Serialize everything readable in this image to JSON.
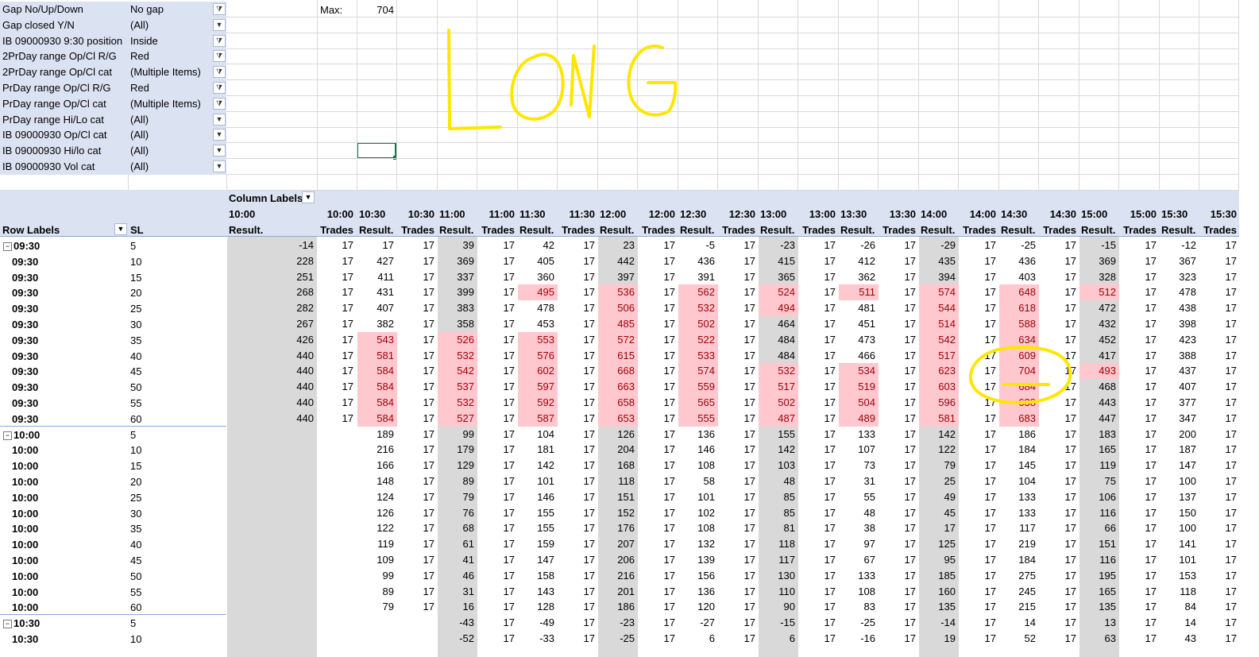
{
  "filters": [
    {
      "label": "Gap No/Up/Down",
      "value": "No gap",
      "filtered": true
    },
    {
      "label": "Gap closed Y/N",
      "value": "(All)",
      "filtered": false
    },
    {
      "label": "IB 09000930 9:30 position",
      "value": "Inside",
      "filtered": true
    },
    {
      "label": "2PrDay range Op/Cl R/G",
      "value": "Red",
      "filtered": true
    },
    {
      "label": "2PrDay range Op/Cl cat",
      "value": "(Multiple Items)",
      "filtered": true
    },
    {
      "label": "PrDay range Op/Cl R/G",
      "value": "Red",
      "filtered": true
    },
    {
      "label": "PrDay range Op/Cl cat",
      "value": "(Multiple Items)",
      "filtered": true
    },
    {
      "label": "PrDay range Hi/Lo cat",
      "value": "(All)",
      "filtered": false
    },
    {
      "label": "IB 09000930 Op/Cl cat",
      "value": "(All)",
      "filtered": false
    },
    {
      "label": "IB 09000930 Hi/lo cat",
      "value": "(All)",
      "filtered": false
    },
    {
      "label": "IB 09000930 Vol cat",
      "value": "(All)",
      "filtered": false
    }
  ],
  "max": {
    "label": "Max:",
    "value": "704"
  },
  "annotation": {
    "text": "LONG",
    "color": "#ffe600"
  },
  "pivot": {
    "column_labels": "Column Labels",
    "row_labels": "Row Labels",
    "sl_header": "SL",
    "times": [
      "10:00",
      "10:30",
      "11:00",
      "11:30",
      "12:00",
      "12:30",
      "13:00",
      "13:30",
      "14:00",
      "14:30",
      "15:00",
      "15:30"
    ],
    "result_label": "Result.",
    "trades_label": "Trades",
    "highlight_color": "#ffc7ce",
    "rows": [
      {
        "label": "09:30",
        "sl": "5",
        "group": true,
        "results": [
          "-14",
          "17",
          "39",
          "42",
          "23",
          "-5",
          "-23",
          "-26",
          "-29",
          "-25",
          "-15",
          "-12"
        ],
        "trades": [
          "17",
          "17",
          "17",
          "17",
          "17",
          "17",
          "17",
          "17",
          "17",
          "17",
          "17",
          "17"
        ],
        "hi": []
      },
      {
        "label": "09:30",
        "sl": "10",
        "group": false,
        "results": [
          "228",
          "427",
          "369",
          "405",
          "442",
          "436",
          "415",
          "412",
          "435",
          "436",
          "369",
          "367"
        ],
        "trades": [
          "17",
          "17",
          "17",
          "17",
          "17",
          "17",
          "17",
          "17",
          "17",
          "17",
          "17",
          "17"
        ],
        "hi": []
      },
      {
        "label": "09:30",
        "sl": "15",
        "group": false,
        "results": [
          "251",
          "411",
          "337",
          "360",
          "397",
          "391",
          "365",
          "362",
          "394",
          "403",
          "328",
          "323"
        ],
        "trades": [
          "17",
          "17",
          "17",
          "17",
          "17",
          "17",
          "17",
          "17",
          "17",
          "17",
          "17",
          "17"
        ],
        "hi": []
      },
      {
        "label": "09:30",
        "sl": "20",
        "group": false,
        "results": [
          "268",
          "431",
          "399",
          "495",
          "536",
          "562",
          "524",
          "511",
          "574",
          "648",
          "512",
          "478"
        ],
        "trades": [
          "17",
          "17",
          "17",
          "17",
          "17",
          "17",
          "17",
          "17",
          "17",
          "17",
          "17",
          "17"
        ],
        "hi": [
          3,
          4,
          5,
          6,
          7,
          8,
          9,
          10
        ]
      },
      {
        "label": "09:30",
        "sl": "25",
        "group": false,
        "results": [
          "282",
          "407",
          "383",
          "478",
          "506",
          "532",
          "494",
          "481",
          "544",
          "618",
          "472",
          "438"
        ],
        "trades": [
          "17",
          "17",
          "17",
          "17",
          "17",
          "17",
          "17",
          "17",
          "17",
          "17",
          "17",
          "17"
        ],
        "hi": [
          4,
          5,
          6,
          8,
          9
        ]
      },
      {
        "label": "09:30",
        "sl": "30",
        "group": false,
        "results": [
          "267",
          "382",
          "358",
          "453",
          "485",
          "502",
          "464",
          "451",
          "514",
          "588",
          "432",
          "398"
        ],
        "trades": [
          "17",
          "17",
          "17",
          "17",
          "17",
          "17",
          "17",
          "17",
          "17",
          "17",
          "17",
          "17"
        ],
        "hi": [
          4,
          5,
          8,
          9
        ]
      },
      {
        "label": "09:30",
        "sl": "35",
        "group": false,
        "results": [
          "426",
          "543",
          "526",
          "553",
          "572",
          "522",
          "484",
          "473",
          "542",
          "634",
          "452",
          "423"
        ],
        "trades": [
          "17",
          "17",
          "17",
          "17",
          "17",
          "17",
          "17",
          "17",
          "17",
          "17",
          "17",
          "17"
        ],
        "hi": [
          1,
          2,
          3,
          4,
          5,
          8,
          9
        ]
      },
      {
        "label": "09:30",
        "sl": "40",
        "group": false,
        "results": [
          "440",
          "581",
          "532",
          "576",
          "615",
          "533",
          "484",
          "466",
          "517",
          "609",
          "417",
          "388"
        ],
        "trades": [
          "17",
          "17",
          "17",
          "17",
          "17",
          "17",
          "17",
          "17",
          "17",
          "17",
          "17",
          "17"
        ],
        "hi": [
          1,
          2,
          3,
          4,
          5,
          8,
          9
        ]
      },
      {
        "label": "09:30",
        "sl": "45",
        "group": false,
        "results": [
          "440",
          "584",
          "542",
          "602",
          "668",
          "574",
          "532",
          "534",
          "623",
          "704",
          "493",
          "437"
        ],
        "trades": [
          "17",
          "17",
          "17",
          "17",
          "17",
          "17",
          "17",
          "17",
          "17",
          "17",
          "17",
          "17"
        ],
        "hi": [
          1,
          2,
          3,
          4,
          5,
          6,
          7,
          8,
          9,
          10
        ]
      },
      {
        "label": "09:30",
        "sl": "50",
        "group": false,
        "results": [
          "440",
          "584",
          "537",
          "597",
          "663",
          "559",
          "517",
          "519",
          "603",
          "684",
          "468",
          "407"
        ],
        "trades": [
          "17",
          "17",
          "17",
          "17",
          "17",
          "17",
          "17",
          "17",
          "17",
          "17",
          "17",
          "17"
        ],
        "hi": [
          1,
          2,
          3,
          4,
          5,
          6,
          7,
          8,
          9
        ]
      },
      {
        "label": "09:30",
        "sl": "55",
        "group": false,
        "results": [
          "440",
          "584",
          "532",
          "592",
          "658",
          "565",
          "502",
          "504",
          "596",
          "638",
          "443",
          "377"
        ],
        "trades": [
          "17",
          "17",
          "17",
          "17",
          "17",
          "17",
          "17",
          "17",
          "17",
          "17",
          "17",
          "17"
        ],
        "hi": [
          1,
          2,
          3,
          4,
          5,
          6,
          7,
          8,
          9
        ]
      },
      {
        "label": "09:30",
        "sl": "60",
        "group": false,
        "results": [
          "440",
          "584",
          "527",
          "587",
          "653",
          "555",
          "487",
          "489",
          "581",
          "683",
          "447",
          "347"
        ],
        "trades": [
          "17",
          "17",
          "17",
          "17",
          "17",
          "17",
          "17",
          "17",
          "17",
          "17",
          "17",
          "17"
        ],
        "hi": [
          1,
          2,
          3,
          4,
          5,
          6,
          7,
          8,
          9
        ]
      },
      {
        "label": "10:00",
        "sl": "5",
        "group": true,
        "results": [
          "",
          "189",
          "99",
          "104",
          "126",
          "136",
          "155",
          "133",
          "142",
          "186",
          "183",
          "200"
        ],
        "trades": [
          "",
          "17",
          "17",
          "17",
          "17",
          "17",
          "17",
          "17",
          "17",
          "17",
          "17",
          "17"
        ],
        "hi": []
      },
      {
        "label": "10:00",
        "sl": "10",
        "group": false,
        "results": [
          "",
          "216",
          "179",
          "181",
          "204",
          "146",
          "142",
          "107",
          "122",
          "184",
          "165",
          "187"
        ],
        "trades": [
          "",
          "17",
          "17",
          "17",
          "17",
          "17",
          "17",
          "17",
          "17",
          "17",
          "17",
          "17"
        ],
        "hi": []
      },
      {
        "label": "10:00",
        "sl": "15",
        "group": false,
        "results": [
          "",
          "166",
          "129",
          "142",
          "168",
          "108",
          "103",
          "73",
          "79",
          "145",
          "119",
          "147"
        ],
        "trades": [
          "",
          "17",
          "17",
          "17",
          "17",
          "17",
          "17",
          "17",
          "17",
          "17",
          "17",
          "17"
        ],
        "hi": []
      },
      {
        "label": "10:00",
        "sl": "20",
        "group": false,
        "results": [
          "",
          "148",
          "89",
          "101",
          "118",
          "58",
          "48",
          "31",
          "25",
          "104",
          "75",
          "100"
        ],
        "trades": [
          "",
          "17",
          "17",
          "17",
          "17",
          "17",
          "17",
          "17",
          "17",
          "17",
          "17",
          "17"
        ],
        "hi": []
      },
      {
        "label": "10:00",
        "sl": "25",
        "group": false,
        "results": [
          "",
          "124",
          "79",
          "146",
          "151",
          "101",
          "85",
          "55",
          "49",
          "133",
          "106",
          "137"
        ],
        "trades": [
          "",
          "17",
          "17",
          "17",
          "17",
          "17",
          "17",
          "17",
          "17",
          "17",
          "17",
          "17"
        ],
        "hi": []
      },
      {
        "label": "10:00",
        "sl": "30",
        "group": false,
        "results": [
          "",
          "126",
          "76",
          "155",
          "152",
          "102",
          "85",
          "48",
          "45",
          "133",
          "116",
          "150"
        ],
        "trades": [
          "",
          "17",
          "17",
          "17",
          "17",
          "17",
          "17",
          "17",
          "17",
          "17",
          "17",
          "17"
        ],
        "hi": []
      },
      {
        "label": "10:00",
        "sl": "35",
        "group": false,
        "results": [
          "",
          "122",
          "68",
          "155",
          "176",
          "108",
          "81",
          "38",
          "17",
          "117",
          "66",
          "100"
        ],
        "trades": [
          "",
          "17",
          "17",
          "17",
          "17",
          "17",
          "17",
          "17",
          "17",
          "17",
          "17",
          "17"
        ],
        "hi": []
      },
      {
        "label": "10:00",
        "sl": "40",
        "group": false,
        "results": [
          "",
          "119",
          "61",
          "159",
          "207",
          "132",
          "118",
          "97",
          "125",
          "219",
          "151",
          "141"
        ],
        "trades": [
          "",
          "17",
          "17",
          "17",
          "17",
          "17",
          "17",
          "17",
          "17",
          "17",
          "17",
          "17"
        ],
        "hi": []
      },
      {
        "label": "10:00",
        "sl": "45",
        "group": false,
        "results": [
          "",
          "109",
          "41",
          "147",
          "206",
          "139",
          "117",
          "67",
          "95",
          "184",
          "116",
          "101"
        ],
        "trades": [
          "",
          "17",
          "17",
          "17",
          "17",
          "17",
          "17",
          "17",
          "17",
          "17",
          "17",
          "17"
        ],
        "hi": []
      },
      {
        "label": "10:00",
        "sl": "50",
        "group": false,
        "results": [
          "",
          "99",
          "46",
          "158",
          "216",
          "156",
          "130",
          "133",
          "185",
          "275",
          "195",
          "153"
        ],
        "trades": [
          "",
          "17",
          "17",
          "17",
          "17",
          "17",
          "17",
          "17",
          "17",
          "17",
          "17",
          "17"
        ],
        "hi": []
      },
      {
        "label": "10:00",
        "sl": "55",
        "group": false,
        "results": [
          "",
          "89",
          "31",
          "143",
          "201",
          "136",
          "110",
          "108",
          "160",
          "245",
          "165",
          "118"
        ],
        "trades": [
          "",
          "17",
          "17",
          "17",
          "17",
          "17",
          "17",
          "17",
          "17",
          "17",
          "17",
          "17"
        ],
        "hi": []
      },
      {
        "label": "10:00",
        "sl": "60",
        "group": false,
        "results": [
          "",
          "79",
          "16",
          "128",
          "186",
          "120",
          "90",
          "83",
          "135",
          "215",
          "135",
          "84"
        ],
        "trades": [
          "",
          "17",
          "17",
          "17",
          "17",
          "17",
          "17",
          "17",
          "17",
          "17",
          "17",
          "17"
        ],
        "hi": []
      },
      {
        "label": "10:30",
        "sl": "5",
        "group": true,
        "results": [
          "",
          "",
          "-43",
          "-49",
          "-23",
          "-27",
          "-15",
          "-25",
          "-14",
          "14",
          "13",
          "14"
        ],
        "trades": [
          "",
          "",
          "17",
          "17",
          "17",
          "17",
          "17",
          "17",
          "17",
          "17",
          "17",
          "17"
        ],
        "hi": []
      },
      {
        "label": "10:30",
        "sl": "10",
        "group": false,
        "results": [
          "",
          "",
          "-52",
          "-33",
          "-25",
          "6",
          "6",
          "-16",
          "19",
          "52",
          "63",
          "43"
        ],
        "trades": [
          "",
          "",
          "17",
          "17",
          "17",
          "17",
          "17",
          "17",
          "17",
          "17",
          "17",
          "17"
        ],
        "hi": []
      }
    ]
  }
}
